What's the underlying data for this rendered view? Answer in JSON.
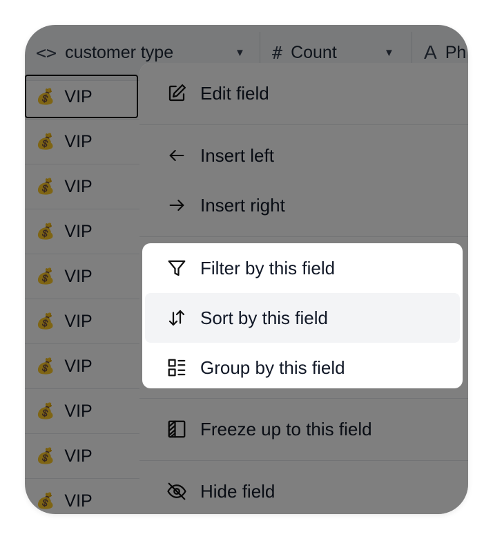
{
  "header": {
    "col1_label": "customer type",
    "col1_icon": "<>",
    "col2_label": "Count",
    "col2_icon": "#",
    "col3_label": "Ph",
    "col3_icon": "A"
  },
  "rows": [
    "VIP",
    "VIP",
    "VIP",
    "VIP",
    "VIP",
    "VIP",
    "VIP",
    "VIP",
    "VIP",
    "VIP"
  ],
  "row_emoji": "💰",
  "menu": {
    "edit_field": "Edit field",
    "insert_left": "Insert left",
    "insert_right": "Insert right",
    "filter": "Filter by this field",
    "sort": "Sort by this field",
    "group": "Group by this field",
    "freeze": "Freeze up to this field",
    "hide": "Hide field"
  }
}
